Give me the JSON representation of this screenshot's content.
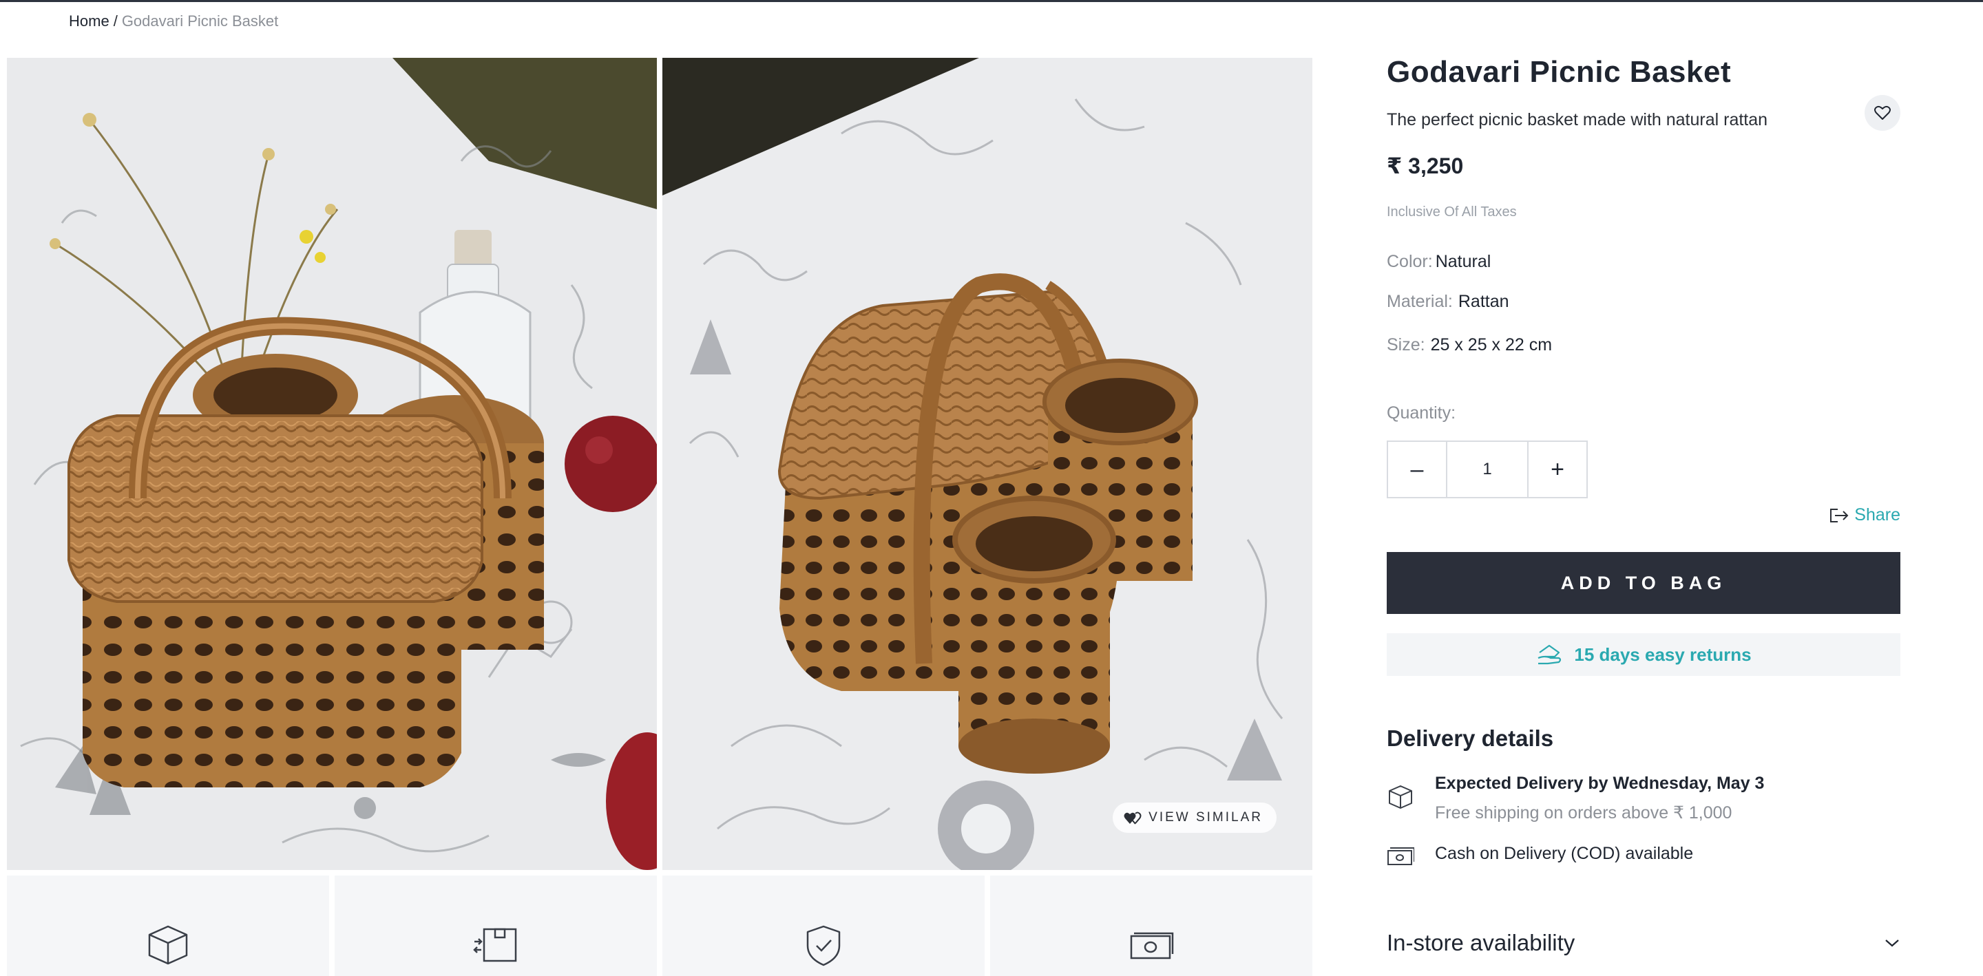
{
  "breadcrumb": {
    "home": "Home",
    "separator": "/",
    "current": "Godavari Picnic Basket"
  },
  "gallery": {
    "view_similar_label": "VIEW SIMILAR",
    "images": [
      {
        "alt": "picnic-basket-front-view"
      },
      {
        "alt": "picnic-basket-side-view"
      }
    ],
    "feature_icons": [
      "box-icon",
      "exchange-box-icon",
      "shield-check-icon",
      "cash-icon"
    ]
  },
  "product": {
    "title": "Godavari Picnic Basket",
    "subtitle": "The perfect picnic basket made with natural rattan",
    "price": "₹ 3,250",
    "tax_note": "Inclusive Of All Taxes",
    "color_label": "Color:",
    "color_value": "Natural",
    "material_label": "Material:",
    "material_value": "Rattan",
    "size_label": "Size:",
    "size_value": "25 x 25 x 22 cm",
    "quantity_label": "Quantity:",
    "quantity_value": "1",
    "minus_label": "–",
    "plus_label": "+",
    "share_label": "Share",
    "add_to_bag_label": "ADD TO BAG",
    "returns_label": "15 days easy returns"
  },
  "delivery": {
    "title": "Delivery details",
    "expected": "Expected Delivery by Wednesday, May 3",
    "free_shipping": "Free shipping on orders above ₹ 1,000",
    "cod": "Cash on Delivery (COD) available"
  },
  "instore": {
    "label": "In-store availability"
  },
  "colors": {
    "accent_teal": "#2aa9b0",
    "button_dark": "#2b2f3a",
    "rattan": "#b07b3f"
  }
}
